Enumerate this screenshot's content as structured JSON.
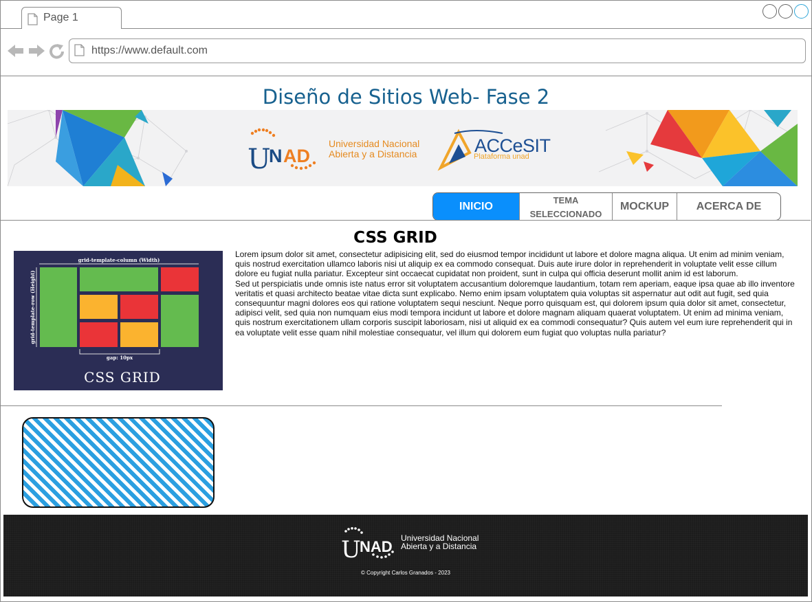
{
  "browser": {
    "tab_label": "Page 1",
    "url": "https://www.default.com"
  },
  "header": {
    "site_title": "Diseño de Sitios Web- Fase 2",
    "banner": {
      "unad_logo": "UNAD",
      "unad_name_line1": "Universidad Nacional",
      "unad_name_line2": "Abierta y a Distancia",
      "accesit_name": "ACCeSIT",
      "accesit_sub": "Plataforma unad"
    }
  },
  "menu": {
    "items": [
      {
        "label": "INICIO",
        "active": true
      },
      {
        "label": "TEMA SELECCIONADO",
        "line1": "TEMA",
        "line2": "SELECCIONADO",
        "active": false
      },
      {
        "label": "MOCKUP",
        "active": false
      },
      {
        "label": "ACERCA DE",
        "active": false
      }
    ],
    "active_color": "#0a8ffc"
  },
  "content": {
    "section_title": "CSS GRID",
    "image": {
      "top_label": "grid-template-column (Width)",
      "side_label": "grid-template-row (Height)",
      "gap_label": "gap: 10px",
      "caption": "CSS GRID"
    },
    "paragraph1": "Lorem ipsum dolor sit amet, consectetur adipisicing elit, sed do eiusmod tempor incididunt ut labore et dolore magna aliqua. Ut enim ad minim veniam, quis nostrud exercitation ullamco laboris nisi ut aliquip ex ea commodo consequat. Duis aute irure dolor in reprehenderit in voluptate velit esse cillum dolore eu fugiat nulla pariatur. Excepteur sint occaecat cupidatat non proident, sunt in culpa qui officia deserunt mollit anim id est laborum.",
    "paragraph2": "Sed ut perspiciatis unde omnis iste natus error sit voluptatem accusantium doloremque laudantium, totam rem aperiam, eaque ipsa quae ab illo inventore veritatis et quasi architecto beatae vitae dicta sunt explicabo. Nemo enim ipsam voluptatem quia voluptas sit aspernatur aut odit aut fugit, sed quia consequuntur magni dolores eos qui ratione voluptatem sequi nesciunt. Neque porro quisquam est, qui dolorem ipsum quia dolor sit amet, consectetur, adipisci velit, sed quia non numquam eius modi tempora incidunt ut labore et dolore magnam aliquam quaerat voluptatem. Ut enim ad minima veniam, quis nostrum exercitationem ullam corporis suscipit laboriosam, nisi ut aliquid ex ea commodi consequatur? Quis autem vel eum iure reprehenderit qui in ea voluptate velit esse quam nihil molestiae consequatur, vel illum qui dolorem eum fugiat quo voluptas nulla pariatur?"
  },
  "footer": {
    "logo": "UNAD",
    "uni_line1": "Universidad Nacional",
    "uni_line2": "Abierta y a Distancia",
    "copyright": "© Copyright Carlos Granados - 2023"
  },
  "colors": {
    "title_blue": "#17618f",
    "grid_green": "#64bb4f",
    "grid_red": "#ea3438",
    "grid_yellow": "#fbb32f",
    "image_bg": "#2b2d55",
    "footer_bg": "#1c1c1c",
    "placeholder_stripe": "#2b9fe0"
  }
}
